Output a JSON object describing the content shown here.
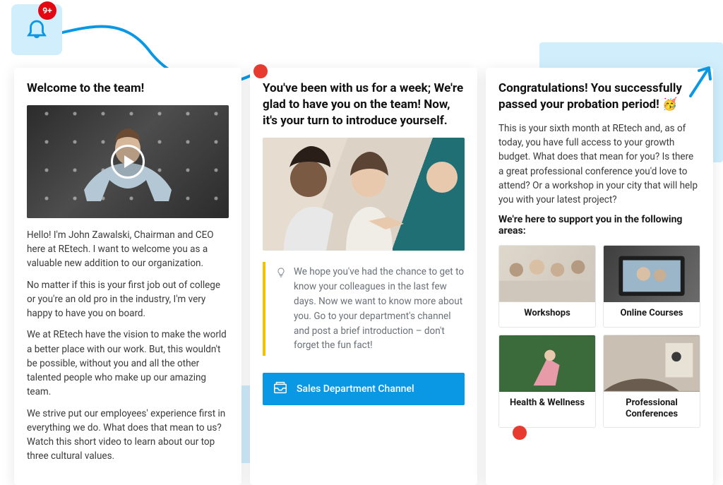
{
  "notification": {
    "badge_text": "9+"
  },
  "cards": [
    {
      "title": "Welcome to the team!",
      "paragraphs": [
        "Hello! I'm John Zawalski, Chairman and CEO here at REtech. I want to welcome you as a valuable new addition to our organization.",
        "No matter if this is your first job out of college or you're an old pro in the industry, I'm very happy to have you on board.",
        "We at REtech have the vision to make the world a better place with our work. But, this wouldn't be possible, without you and all the other talented people who make up our amazing team.",
        "We strive put our employees' experience first in everything we do. What does that mean to us? Watch this short video to learn about our top three cultural values."
      ]
    },
    {
      "title": "You've been with us for a week; We're glad to have you on the team! Now, it's your turn to introduce yourself.",
      "callout": "We hope you've had the chance to get to know your colleagues in the last few days. Now we want to know more about you. Go to your department's channel and post a brief introduction – don't forget the fun fact!",
      "cta_label": "Sales Department Channel"
    },
    {
      "title": "Congratulations! You successfully passed your probation period! 🥳",
      "intro": "This is your sixth month at REtech and, as of today, you have full access to your growth budget. What does that mean for you? Is there a great professional conference you'd love to attend? Or a workshop in your city that will help you with your latest project?",
      "subhead": "We're here to support you in the following areas:",
      "tiles": [
        {
          "label": "Workshops"
        },
        {
          "label": "Online Courses"
        },
        {
          "label": "Health & Wellness"
        },
        {
          "label": "Professional Conferences"
        }
      ]
    }
  ]
}
